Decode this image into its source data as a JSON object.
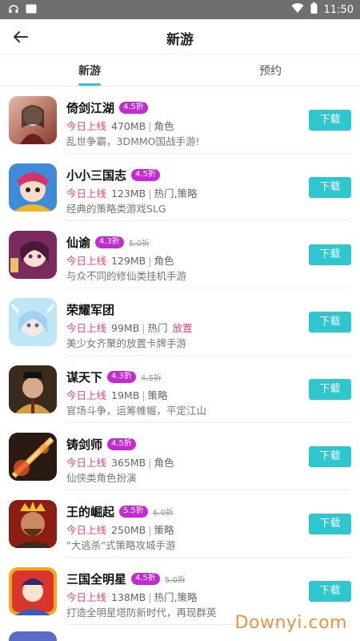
{
  "status_bar": {
    "time": "11:50"
  },
  "header": {
    "title": "新游",
    "back_icon": "arrow-left-icon"
  },
  "tabs": [
    {
      "label": "新游",
      "active": true
    },
    {
      "label": "预约",
      "active": false
    }
  ],
  "accent_color": "#2ec7d0",
  "badge_color": "#c42ad2",
  "online_color": "#e7447a",
  "games": [
    {
      "name": "倚剑江湖",
      "discount": "4.5折",
      "old_price": "",
      "online": "今日上线",
      "size": "470MB",
      "category": "角色",
      "extra": "",
      "desc": "乱世争霸，3DMMO国战手游!",
      "button": "下载"
    },
    {
      "name": "小小三国志",
      "discount": "4.5折",
      "old_price": "",
      "online": "今日上线",
      "size": "123MB",
      "category": "热门,策略",
      "extra": "",
      "desc": "经典的策略类游戏SLG",
      "button": "下载"
    },
    {
      "name": "仙谕",
      "discount": "4.3折",
      "old_price": "5.0折",
      "online": "今日上线",
      "size": "129MB",
      "category": "角色",
      "extra": "",
      "desc": "与众不同的修仙类挂机手游",
      "button": "下载"
    },
    {
      "name": "荣耀军团",
      "discount": "",
      "old_price": "",
      "online": "今日上线",
      "size": "99MB",
      "category": "热门",
      "extra": "放置",
      "desc": "美少女齐聚的放置卡牌手游",
      "button": "下载"
    },
    {
      "name": "谋天下",
      "discount": "4.3折",
      "old_price": "4.5折",
      "online": "今日上线",
      "size": "19MB",
      "category": "策略",
      "extra": "",
      "desc": "官场斗争，运筹帷幄，平定江山",
      "button": "下载"
    },
    {
      "name": "铸剑师",
      "discount": "4.5折",
      "old_price": "",
      "online": "今日上线",
      "size": "365MB",
      "category": "角色",
      "extra": "",
      "desc": "仙侠类角色扮演",
      "button": "下载"
    },
    {
      "name": "王的崛起",
      "discount": "5.5折",
      "old_price": "6.0折",
      "online": "今日上线",
      "size": "250MB",
      "category": "策略",
      "extra": "",
      "desc": "\"大逃杀\"式策略攻城手游",
      "button": "下载"
    },
    {
      "name": "三国全明星",
      "discount": "4.5折",
      "old_price": "5.0折",
      "online": "今日上线",
      "size": "138MB",
      "category": "热门,策略",
      "extra": "",
      "desc": "打造全明星塔防新时代，再现群英",
      "button": "下载"
    }
  ],
  "watermark": "Downyi.com"
}
